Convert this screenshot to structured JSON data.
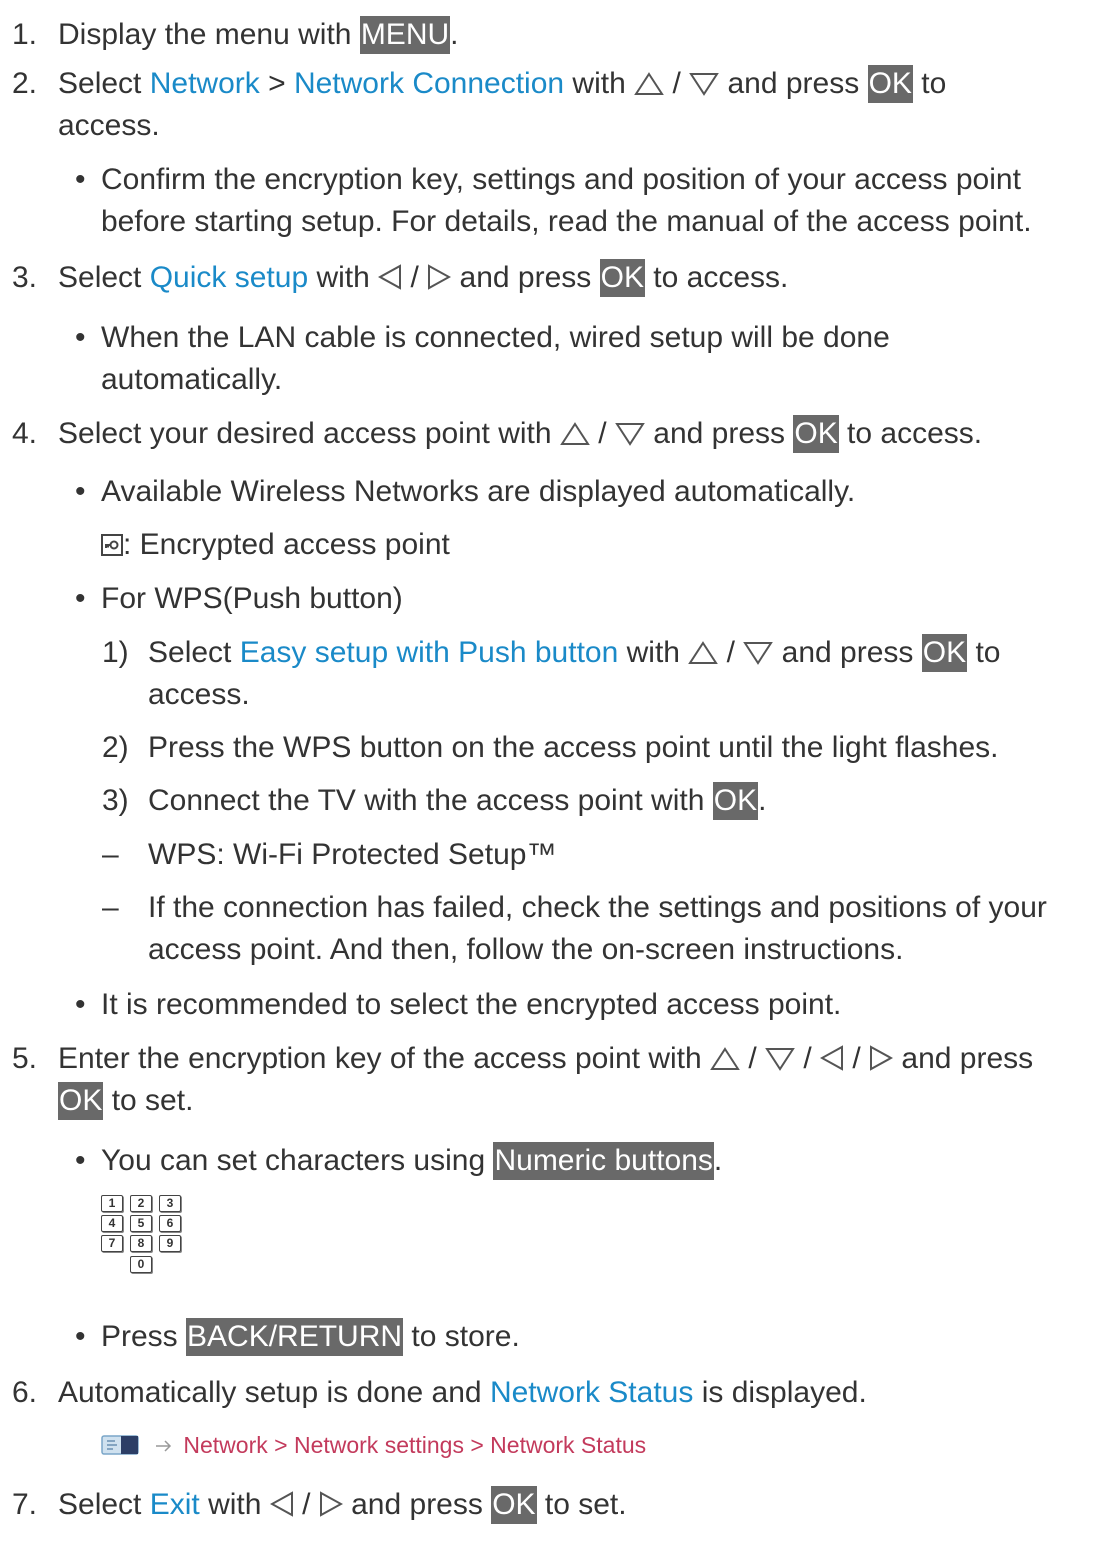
{
  "steps": [
    {
      "num": "1.",
      "t1": "Display the menu with ",
      "key": "MENU",
      "t2": "."
    },
    {
      "num": "2.",
      "t1": "Select ",
      "link1": "Network",
      "t2": " > ",
      "link2": "Network Connection",
      "t3": " with ",
      "t4": " / ",
      "t5": " and press ",
      "key": "OK",
      "t6": " to",
      "line2": "access."
    },
    {
      "num": "3.",
      "t1": "Select ",
      "link1": "Quick setup",
      "t2": " with ",
      "t3": " / ",
      "t4": " and press ",
      "key": "OK",
      "t5": " to access."
    },
    {
      "num": "4.",
      "t1": "Select your desired access point with ",
      "t2": " / ",
      "t3": " and press ",
      "key": "OK",
      "t4": " to access."
    },
    {
      "num": "5.",
      "t1": "Enter the encryption key of the access point with ",
      "s1": " / ",
      "s2": " / ",
      "s3": " / ",
      "t2": " and press",
      "key": "OK",
      "t3": " to set."
    },
    {
      "num": "6.",
      "t1": "Automatically setup is done and ",
      "link1": "Network Status",
      "t2": " is displayed."
    },
    {
      "num": "7.",
      "t1": "Select ",
      "link1": "Exit",
      "t2": " with ",
      "t3": " / ",
      "t4": " and press ",
      "key": "OK",
      "t5": " to set."
    }
  ],
  "bullets": {
    "b2": {
      "l1": "Confirm the encryption key, settings and position of your access point",
      "l2": "before starting setup. For details, read the manual of the access point."
    },
    "b3": {
      "l1": "When the LAN cable is connected, wired setup will be done",
      "l2": "automatically."
    },
    "b4a": "Available Wireless Networks are displayed automatically.",
    "b4a_icon_text": ": Encrypted access point",
    "b4b": "For WPS(Push button)",
    "wps1": {
      "num": "1)",
      "t1": "Select ",
      "link": "Easy setup with Push button",
      "t2": " with ",
      "t3": " / ",
      "t4": " and press ",
      "key": "OK",
      "t5": " to",
      "line2": "access."
    },
    "wps2": {
      "num": "2)",
      "text": "Press the WPS button on the access point until the light flashes."
    },
    "wps3": {
      "num": "3)",
      "t1": "Connect the TV with the access point with ",
      "key": "OK",
      "t2": "."
    },
    "dash1": "WPS: Wi-Fi Protected Setup™",
    "dash2": {
      "l1": "If the connection has failed, check the settings and positions of your",
      "l2": "access point. And then, follow the on-screen instructions."
    },
    "b4c": "It is recommended to select the encrypted access point.",
    "b5a": {
      "t1": "You can set characters using ",
      "key": "Numeric buttons",
      "t2": "."
    },
    "b5b": {
      "t1": "Press ",
      "key": "BACK/RETURN",
      "t2": " to store."
    }
  },
  "numpad": [
    "1",
    "2",
    "3",
    "4",
    "5",
    "6",
    "7",
    "8",
    "9",
    "0"
  ],
  "bullet_char": "•",
  "dash_char": "–",
  "path6": "Network > Network settings > Network Status",
  "colors": {
    "link": "#1a8ac8",
    "path_link": "#c33a5c",
    "key_bg": "#696969",
    "text": "#333333"
  }
}
